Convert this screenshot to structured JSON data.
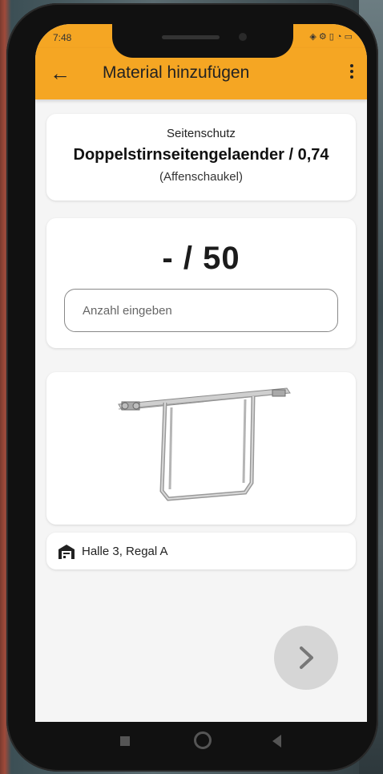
{
  "status": {
    "time": "7:48",
    "icons": "◈ ⚙   ▯ ◔ ▭"
  },
  "appbar": {
    "title": "Material hinzufügen",
    "back_icon": "arrow-left",
    "menu_icon": "more-vert"
  },
  "material": {
    "category": "Seitenschutz",
    "name": "Doppelstirnseitengelaender / 0,74",
    "subname": "(Affenschaukel)"
  },
  "quantity": {
    "display": "- / 50",
    "placeholder": "Anzahl eingeben"
  },
  "location": {
    "text": "Halle 3, Regal A",
    "icon": "warehouse-icon"
  },
  "fab": {
    "icon": "chevron-right"
  },
  "colors": {
    "accent": "#f5a623",
    "background": "#f5f5f5",
    "card": "#ffffff"
  }
}
